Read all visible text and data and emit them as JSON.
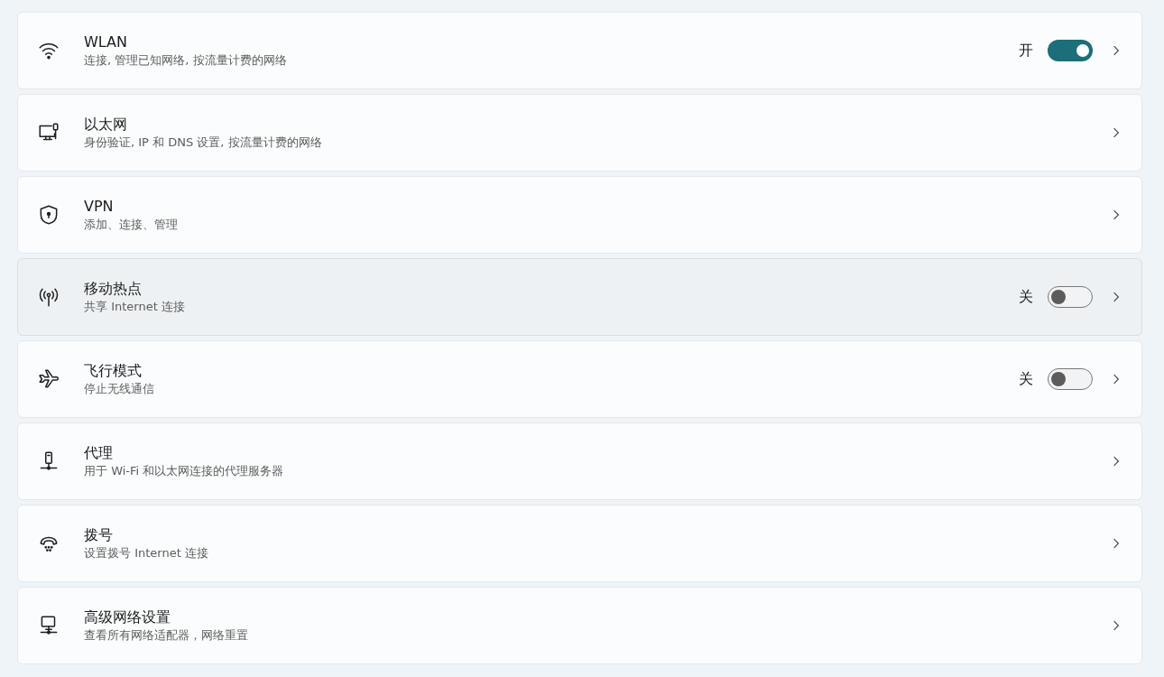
{
  "settings": [
    {
      "title": "WLAN",
      "description": "连接, 管理已知网络, 按流量计费的网络",
      "highlighted": false,
      "toggle": {
        "label": "开",
        "on": true
      }
    },
    {
      "title": "以太网",
      "description": "身份验证, IP 和 DNS 设置, 按流量计费的网络",
      "highlighted": false
    },
    {
      "title": "VPN",
      "description": "添加、连接、管理",
      "highlighted": false
    },
    {
      "title": "移动热点",
      "description": "共享 Internet 连接",
      "highlighted": true,
      "toggle": {
        "label": "关",
        "on": false
      }
    },
    {
      "title": "飞行模式",
      "description": "停止无线通信",
      "highlighted": false,
      "toggle": {
        "label": "关",
        "on": false
      }
    },
    {
      "title": "代理",
      "description": "用于 Wi-Fi 和以太网连接的代理服务器",
      "highlighted": false
    },
    {
      "title": "拨号",
      "description": "设置拨号 Internet 连接",
      "highlighted": false
    },
    {
      "title": "高级网络设置",
      "description": "查看所有网络适配器，网络重置",
      "highlighted": false
    }
  ]
}
